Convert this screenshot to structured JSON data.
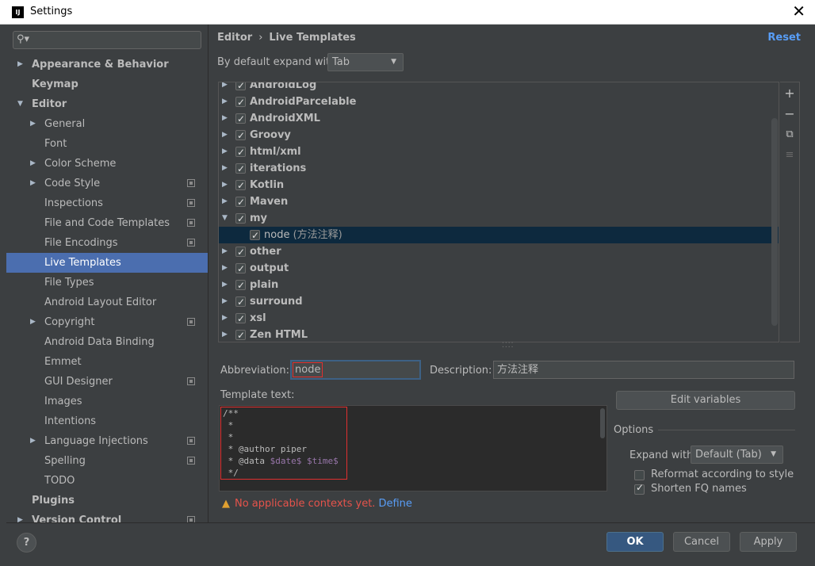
{
  "window": {
    "title": "Settings",
    "logo": "IJ"
  },
  "search": {
    "placeholder": ""
  },
  "sidebar": {
    "items": [
      {
        "label": "Appearance & Behavior",
        "arrow": "▶",
        "bold": true,
        "indent": 1
      },
      {
        "label": "Keymap",
        "bold": true,
        "indent": 1
      },
      {
        "label": "Editor",
        "arrow": "▼",
        "bold": true,
        "indent": 1
      },
      {
        "label": "General",
        "arrow": "▶",
        "indent": 2
      },
      {
        "label": "Font",
        "indent": 2
      },
      {
        "label": "Color Scheme",
        "arrow": "▶",
        "indent": 2
      },
      {
        "label": "Code Style",
        "arrow": "▶",
        "indent": 2,
        "proj": true
      },
      {
        "label": "Inspections",
        "indent": 2,
        "proj": true
      },
      {
        "label": "File and Code Templates",
        "indent": 2,
        "proj": true
      },
      {
        "label": "File Encodings",
        "indent": 2,
        "proj": true
      },
      {
        "label": "Live Templates",
        "indent": 2,
        "selected": true
      },
      {
        "label": "File Types",
        "indent": 2
      },
      {
        "label": "Android Layout Editor",
        "indent": 2
      },
      {
        "label": "Copyright",
        "arrow": "▶",
        "indent": 2,
        "proj": true
      },
      {
        "label": "Android Data Binding",
        "indent": 2
      },
      {
        "label": "Emmet",
        "indent": 2
      },
      {
        "label": "GUI Designer",
        "indent": 2,
        "proj": true
      },
      {
        "label": "Images",
        "indent": 2
      },
      {
        "label": "Intentions",
        "indent": 2
      },
      {
        "label": "Language Injections",
        "arrow": "▶",
        "indent": 2,
        "proj": true
      },
      {
        "label": "Spelling",
        "indent": 2,
        "proj": true
      },
      {
        "label": "TODO",
        "indent": 2
      },
      {
        "label": "Plugins",
        "bold": true,
        "indent": 1
      },
      {
        "label": "Version Control",
        "arrow": "▶",
        "bold": true,
        "indent": 1,
        "proj": true
      }
    ]
  },
  "header": {
    "breadcrumb_parent": "Editor",
    "breadcrumb_sep": "›",
    "breadcrumb_current": "Live Templates",
    "reset": "Reset"
  },
  "expand": {
    "label": "By default expand with",
    "value": "Tab"
  },
  "templates": [
    {
      "name": "AndroidLog",
      "arrow": "▶"
    },
    {
      "name": "AndroidParcelable",
      "arrow": "▶"
    },
    {
      "name": "AndroidXML",
      "arrow": "▶"
    },
    {
      "name": "Groovy",
      "arrow": "▶"
    },
    {
      "name": "html/xml",
      "arrow": "▶"
    },
    {
      "name": "iterations",
      "arrow": "▶"
    },
    {
      "name": "Kotlin",
      "arrow": "▶"
    },
    {
      "name": "Maven",
      "arrow": "▶"
    },
    {
      "name": "my",
      "arrow": "▼"
    },
    {
      "name": "node",
      "desc": " (方法注释)",
      "child": true,
      "selected": true
    },
    {
      "name": "other",
      "arrow": "▶"
    },
    {
      "name": "output",
      "arrow": "▶"
    },
    {
      "name": "plain",
      "arrow": "▶"
    },
    {
      "name": "surround",
      "arrow": "▶"
    },
    {
      "name": "xsl",
      "arrow": "▶"
    },
    {
      "name": "Zen HTML",
      "arrow": "▶"
    }
  ],
  "tools": {
    "add": "+",
    "remove": "−",
    "copy": "⧉",
    "disabled": "≡"
  },
  "abbreviation": {
    "label": "Abbreviation:",
    "value": "node"
  },
  "description": {
    "label": "Description:",
    "value": "方法注释"
  },
  "template_text": {
    "label": "Template text:",
    "lines": [
      "/**",
      " *",
      " *",
      " * @author piper",
      " * @data $date$ $time$",
      " */"
    ]
  },
  "warning": {
    "text": "No applicable contexts yet.",
    "link": "Define"
  },
  "edit_variables": "Edit variables",
  "options": {
    "label": "Options",
    "expand_with_label": "Expand with",
    "expand_with_value": "Default (Tab)",
    "reformat": {
      "label": "Reformat according to style",
      "checked": false
    },
    "shorten": {
      "label": "Shorten FQ names",
      "checked": true
    }
  },
  "buttons": {
    "help": "?",
    "ok": "OK",
    "cancel": "Cancel",
    "apply": "Apply"
  }
}
